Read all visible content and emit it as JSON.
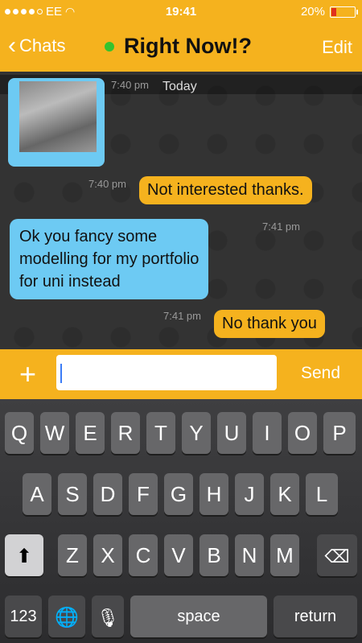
{
  "status": {
    "carrier": "EE",
    "time": "19:41",
    "battery": "20%",
    "battery_level": 0.2
  },
  "nav": {
    "back": "Chats",
    "title": "Right Now!?",
    "edit": "Edit"
  },
  "chat": {
    "day_label": "Today",
    "messages": [
      {
        "side": "left",
        "type": "image",
        "time": "7:40 pm"
      },
      {
        "side": "right",
        "text": "Not interested thanks.",
        "time": "7:40 pm"
      },
      {
        "side": "left",
        "text_lines": [
          "Ok you fancy some",
          "modelling for my portfolio",
          "for uni instead"
        ],
        "time": "7:41 pm"
      },
      {
        "side": "right",
        "text": "No thank you",
        "time": "7:41 pm"
      }
    ]
  },
  "compose": {
    "plus": "+",
    "value": "",
    "send": "Send"
  },
  "keyboard": {
    "row1": [
      "Q",
      "W",
      "E",
      "R",
      "T",
      "Y",
      "U",
      "I",
      "O",
      "P"
    ],
    "row2": [
      "A",
      "S",
      "D",
      "F",
      "G",
      "H",
      "J",
      "K",
      "L"
    ],
    "row3": [
      "Z",
      "X",
      "C",
      "V",
      "B",
      "N",
      "M"
    ],
    "numbers": "123",
    "space": "space",
    "return": "return"
  },
  "colors": {
    "accent": "#f5b21e",
    "incoming": "#6dcaf3",
    "online": "#35c32e"
  }
}
